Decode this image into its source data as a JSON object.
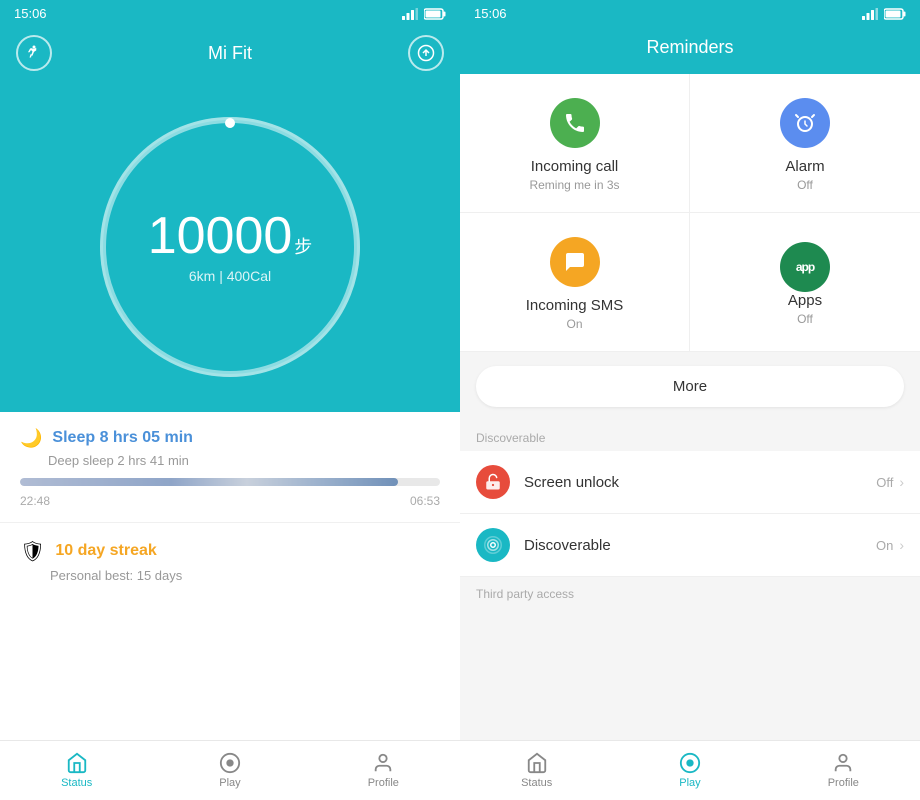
{
  "left": {
    "status_time": "15:06",
    "app_name": "Mi Fit",
    "steps": "10000",
    "steps_unit": "步",
    "distance_cal": "6km | 400Cal",
    "sleep_title": "Sleep ",
    "sleep_bold": "8 hrs 05 min",
    "sleep_sub": "Deep sleep 2 hrs 41 min",
    "sleep_start": "22:48",
    "sleep_end": "06:53",
    "streak_title": "10 day streak",
    "streak_sub": "Personal best: 15 days",
    "nav": {
      "status": "Status",
      "play": "Play",
      "profile": "Profile"
    }
  },
  "right": {
    "status_time": "15:06",
    "title": "Reminders",
    "reminders": [
      {
        "name": "Incoming call",
        "status": "Reming me in 3s",
        "color": "green"
      },
      {
        "name": "Alarm",
        "status": "Off",
        "color": "blue"
      },
      {
        "name": "Incoming SMS",
        "status": "On",
        "color": "orange"
      },
      {
        "name": "Apps",
        "status": "Off",
        "color": "teal"
      }
    ],
    "more_button": "More",
    "discoverable_label": "Discoverable",
    "screen_unlock": {
      "name": "Screen unlock",
      "value": "Off"
    },
    "discoverable": {
      "name": "Discoverable",
      "value": "On"
    },
    "third_party_label": "Third party access",
    "nav": {
      "status": "Status",
      "play": "Play",
      "profile": "Profile"
    }
  }
}
